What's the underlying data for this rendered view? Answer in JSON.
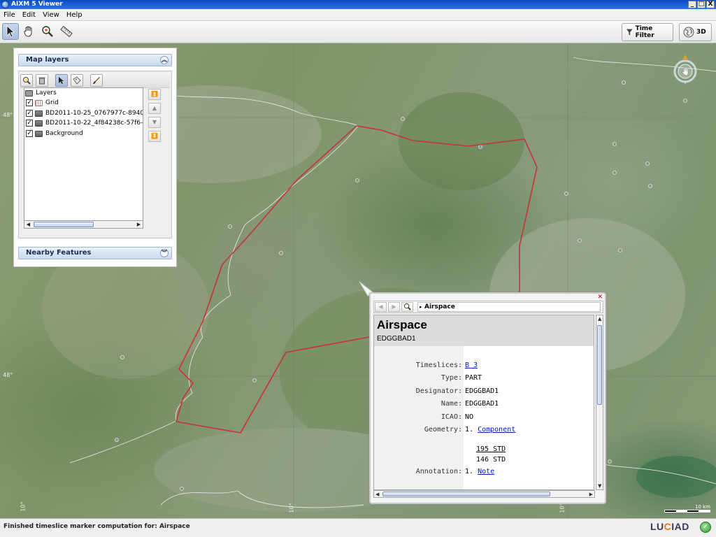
{
  "window": {
    "title": "AIXM 5 Viewer",
    "controls": [
      "_",
      "□",
      "X"
    ]
  },
  "menu": [
    "File",
    "Edit",
    "View",
    "Help"
  ],
  "toolbar": {
    "tools": [
      "select-arrow-icon",
      "pan-hand-icon",
      "zoom-magnifier-icon",
      "ruler-icon"
    ],
    "time_filter_label": "Time Filter",
    "view_3d_label": "3D"
  },
  "map": {
    "coord_labels": [
      "48°",
      "48°",
      "10°",
      "10°",
      "10°"
    ],
    "scale_label": "10 km"
  },
  "map_layers": {
    "title": "Map layers",
    "tools": [
      "find-layer-icon",
      "delete-icon",
      "select-tool-icon",
      "label-tool-icon",
      "brush-icon"
    ],
    "items": [
      {
        "label": "Layers",
        "checked": null,
        "icon": "folder-icon"
      },
      {
        "label": "Grid",
        "checked": true,
        "icon": "grid-icon"
      },
      {
        "label": "BD2011-10-25_0767977c-8940",
        "checked": true,
        "icon": "layer-icon"
      },
      {
        "label": "BD2011-10-22_4f84238c-57f6-",
        "checked": true,
        "icon": "layer-icon"
      },
      {
        "label": "Background",
        "checked": true,
        "icon": "layer-icon"
      }
    ],
    "order_buttons": [
      "move-top-icon",
      "move-up-icon",
      "move-down-icon",
      "move-bottom-icon"
    ]
  },
  "nearby": {
    "title": "Nearby Features"
  },
  "balloon": {
    "breadcrumb": "Airspace",
    "title": "Airspace",
    "subtitle": "EDGGBAD1",
    "rows": [
      {
        "key": "Timeslices:",
        "value": "B 3",
        "link": true
      },
      {
        "key": "Type:",
        "value": "PART",
        "link": false
      },
      {
        "key": "Designator:",
        "value": "EDGGBAD1",
        "link": false
      },
      {
        "key": "Name:",
        "value": "EDGGBAD1",
        "link": false
      },
      {
        "key": "ICAO:",
        "value": "NO",
        "link": false
      },
      {
        "key": "Geometry:",
        "prefix": "1.",
        "value": "Component",
        "link": true
      },
      {
        "key": "",
        "value": "195 STD",
        "link": false,
        "underline": true
      },
      {
        "key": "",
        "value": "146 STD",
        "link": false
      },
      {
        "key": "Annotation:",
        "prefix": "1.",
        "value": "Note",
        "link": true
      }
    ]
  },
  "status": {
    "text": "Finished timeslice marker computation for: Airspace",
    "brand": "LUCIAD"
  },
  "colors": {
    "airspace_outline": "#c8323c",
    "accent": "#0a4fc2",
    "brand_orange": "#e07a16"
  }
}
